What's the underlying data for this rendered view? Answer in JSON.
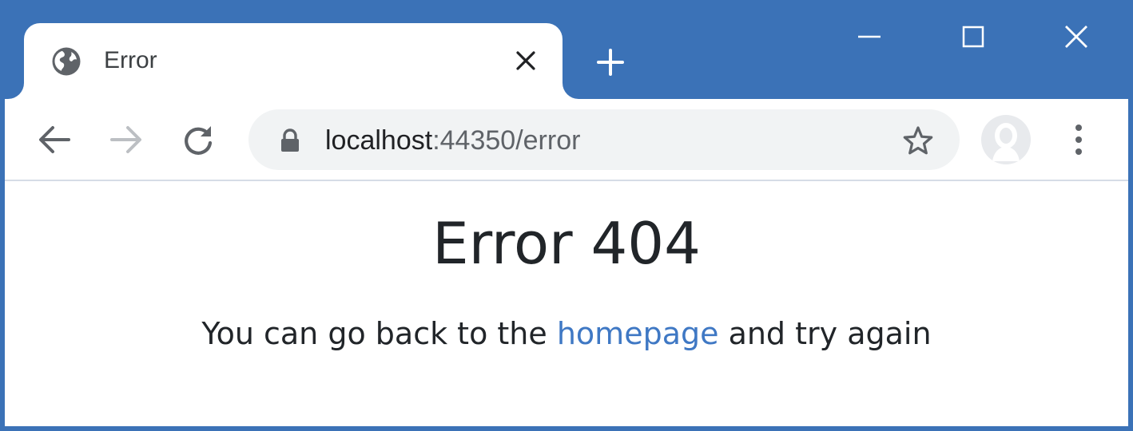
{
  "tab": {
    "title": "Error",
    "favicon": "globe-icon"
  },
  "toolbar": {
    "url_host": "localhost",
    "url_rest": ":44350/error"
  },
  "page": {
    "heading": "Error 404",
    "message_before": "You can go back to the ",
    "link_text": "homepage",
    "message_after": " and try again"
  },
  "colors": {
    "frame": "#3b72b7",
    "link": "#3f78c4",
    "text": "#212529"
  }
}
